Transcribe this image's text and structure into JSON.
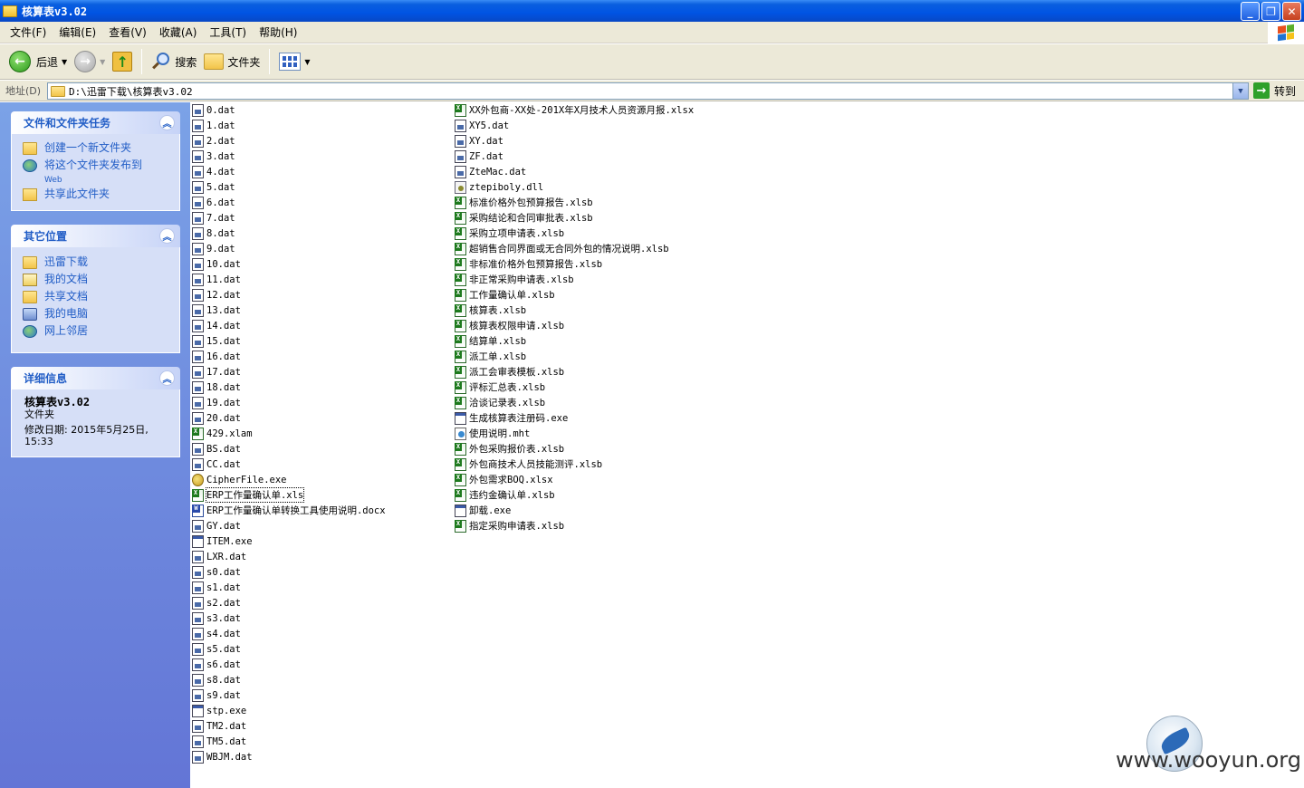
{
  "window": {
    "title": "核算表v3.02"
  },
  "menu": [
    "文件(F)",
    "编辑(E)",
    "查看(V)",
    "收藏(A)",
    "工具(T)",
    "帮助(H)"
  ],
  "toolbar": {
    "back": "后退",
    "search": "搜索",
    "folders": "文件夹"
  },
  "address": {
    "label": "地址(D)",
    "value": "D:\\迅雷下载\\核算表v3.02",
    "go": "转到"
  },
  "sidebar": {
    "tasks": {
      "title": "文件和文件夹任务",
      "items": [
        "创建一个新文件夹",
        "将这个文件夹发布到",
        "共享此文件夹"
      ],
      "publish_sub": "Web"
    },
    "places": {
      "title": "其它位置",
      "items": [
        "迅雷下载",
        "我的文档",
        "共享文档",
        "我的电脑",
        "网上邻居"
      ]
    },
    "details": {
      "title": "详细信息",
      "name": "核算表v3.02",
      "type": "文件夹",
      "modified": "修改日期: 2015年5月25日,",
      "time": "15:33"
    }
  },
  "files": {
    "col1": [
      {
        "name": "0.dat",
        "type": "dat"
      },
      {
        "name": "1.dat",
        "type": "dat"
      },
      {
        "name": "2.dat",
        "type": "dat"
      },
      {
        "name": "3.dat",
        "type": "dat"
      },
      {
        "name": "4.dat",
        "type": "dat"
      },
      {
        "name": "5.dat",
        "type": "dat"
      },
      {
        "name": "6.dat",
        "type": "dat"
      },
      {
        "name": "7.dat",
        "type": "dat"
      },
      {
        "name": "8.dat",
        "type": "dat"
      },
      {
        "name": "9.dat",
        "type": "dat"
      },
      {
        "name": "10.dat",
        "type": "dat"
      },
      {
        "name": "11.dat",
        "type": "dat"
      },
      {
        "name": "12.dat",
        "type": "dat"
      },
      {
        "name": "13.dat",
        "type": "dat"
      },
      {
        "name": "14.dat",
        "type": "dat"
      },
      {
        "name": "15.dat",
        "type": "dat"
      },
      {
        "name": "16.dat",
        "type": "dat"
      },
      {
        "name": "17.dat",
        "type": "dat"
      },
      {
        "name": "18.dat",
        "type": "dat"
      },
      {
        "name": "19.dat",
        "type": "dat"
      },
      {
        "name": "20.dat",
        "type": "dat"
      },
      {
        "name": "429.xlam",
        "type": "xls"
      },
      {
        "name": "BS.dat",
        "type": "dat"
      },
      {
        "name": "CC.dat",
        "type": "dat"
      },
      {
        "name": "CipherFile.exe",
        "type": "cipher"
      },
      {
        "name": "ERP工作量确认单.xls",
        "type": "xls",
        "selected": true
      },
      {
        "name": "ERP工作量确认单转换工具使用说明.docx",
        "type": "doc"
      },
      {
        "name": "GY.dat",
        "type": "dat"
      },
      {
        "name": "ITEM.exe",
        "type": "exe"
      },
      {
        "name": "LXR.dat",
        "type": "dat"
      },
      {
        "name": "s0.dat",
        "type": "dat"
      },
      {
        "name": "s1.dat",
        "type": "dat"
      },
      {
        "name": "s2.dat",
        "type": "dat"
      },
      {
        "name": "s3.dat",
        "type": "dat"
      },
      {
        "name": "s4.dat",
        "type": "dat"
      },
      {
        "name": "s5.dat",
        "type": "dat"
      },
      {
        "name": "s6.dat",
        "type": "dat"
      },
      {
        "name": "s8.dat",
        "type": "dat"
      },
      {
        "name": "s9.dat",
        "type": "dat"
      },
      {
        "name": "stp.exe",
        "type": "exe"
      },
      {
        "name": "TM2.dat",
        "type": "dat"
      },
      {
        "name": "TM5.dat",
        "type": "dat"
      },
      {
        "name": "WBJM.dat",
        "type": "dat"
      }
    ],
    "col2": [
      {
        "name": "XX外包商-XX处-201X年X月技术人员资源月报.xlsx",
        "type": "xls"
      },
      {
        "name": "XY5.dat",
        "type": "dat"
      },
      {
        "name": "XY.dat",
        "type": "dat"
      },
      {
        "name": "ZF.dat",
        "type": "dat"
      },
      {
        "name": "ZteMac.dat",
        "type": "dat"
      },
      {
        "name": "ztepiboly.dll",
        "type": "dll"
      },
      {
        "name": "标准价格外包预算报告.xlsb",
        "type": "xls"
      },
      {
        "name": "采购结论和合同审批表.xlsb",
        "type": "xls"
      },
      {
        "name": "采购立项申请表.xlsb",
        "type": "xls"
      },
      {
        "name": "超销售合同界面或无合同外包的情况说明.xlsb",
        "type": "xls"
      },
      {
        "name": "非标准价格外包预算报告.xlsb",
        "type": "xls"
      },
      {
        "name": "非正常采购申请表.xlsb",
        "type": "xls"
      },
      {
        "name": "工作量确认单.xlsb",
        "type": "xls"
      },
      {
        "name": "核算表.xlsb",
        "type": "xls"
      },
      {
        "name": "核算表权限申请.xlsb",
        "type": "xls"
      },
      {
        "name": "结算单.xlsb",
        "type": "xls"
      },
      {
        "name": "派工单.xlsb",
        "type": "xls"
      },
      {
        "name": "派工会审表模板.xlsb",
        "type": "xls"
      },
      {
        "name": "评标汇总表.xlsb",
        "type": "xls"
      },
      {
        "name": "洽谈记录表.xlsb",
        "type": "xls"
      },
      {
        "name": "生成核算表注册码.exe",
        "type": "exe"
      },
      {
        "name": "使用说明.mht",
        "type": "mht"
      },
      {
        "name": "外包采购报价表.xlsb",
        "type": "xls"
      },
      {
        "name": "外包商技术人员技能测评.xlsb",
        "type": "xls"
      },
      {
        "name": "外包需求BOQ.xlsx",
        "type": "xls"
      },
      {
        "name": "违约金确认单.xlsb",
        "type": "xls"
      },
      {
        "name": "卸载.exe",
        "type": "exe"
      },
      {
        "name": "指定采购申请表.xlsb",
        "type": "xls"
      }
    ]
  },
  "watermark": "www.wooyun.org"
}
